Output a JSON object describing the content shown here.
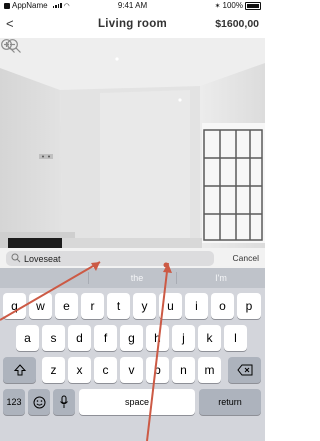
{
  "status": {
    "app_name": "AppName",
    "time": "9:41 AM",
    "battery": "100%"
  },
  "nav": {
    "back": "<",
    "title": "Living room",
    "price": "$1600,00"
  },
  "search": {
    "value": "Loveseat",
    "cancel": "Cancel"
  },
  "suggestions": [
    "the",
    "I'm"
  ],
  "keyboard": {
    "row1": [
      "q",
      "w",
      "e",
      "r",
      "t",
      "y",
      "u",
      "i",
      "o",
      "p"
    ],
    "row2": [
      "a",
      "s",
      "d",
      "f",
      "g",
      "h",
      "j",
      "k",
      "l"
    ],
    "row3": [
      "z",
      "x",
      "c",
      "v",
      "b",
      "n",
      "m"
    ],
    "numbers": "123",
    "space": "space",
    "return": "return"
  },
  "colors": {
    "accent_arrow": "#cc5a45",
    "keyboard_bg": "#d3d5db"
  },
  "icons": [
    "zoom-out-icon",
    "zoom-in-icon",
    "search-icon",
    "shift-icon",
    "backspace-icon",
    "emoji-icon",
    "microphone-icon"
  ]
}
